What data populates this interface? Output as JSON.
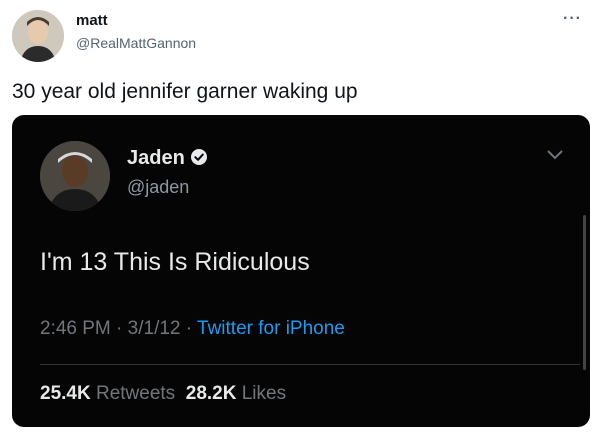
{
  "outer_tweet": {
    "display_name": "matt",
    "handle": "@RealMattGannon",
    "more_label": "···",
    "text": "30 year old jennifer garner waking up"
  },
  "quoted_tweet": {
    "display_name": "Jaden",
    "handle": "@jaden",
    "text": "I'm 13 This Is Ridiculous",
    "time": "2:46 PM",
    "sep1": " · ",
    "date": "3/1/12",
    "sep2": " · ",
    "source": "Twitter for iPhone",
    "retweets_count": "25.4K",
    "retweets_label": "Retweets",
    "likes_count": "28.2K",
    "likes_label": "Likes"
  },
  "colors": {
    "verified_blue": "#1d9bf0",
    "card_bg": "#050505",
    "link_blue": "#1d9bf0"
  },
  "icons": [
    "verified-badge-icon",
    "chevron-down-icon",
    "more-dots-icon"
  ]
}
